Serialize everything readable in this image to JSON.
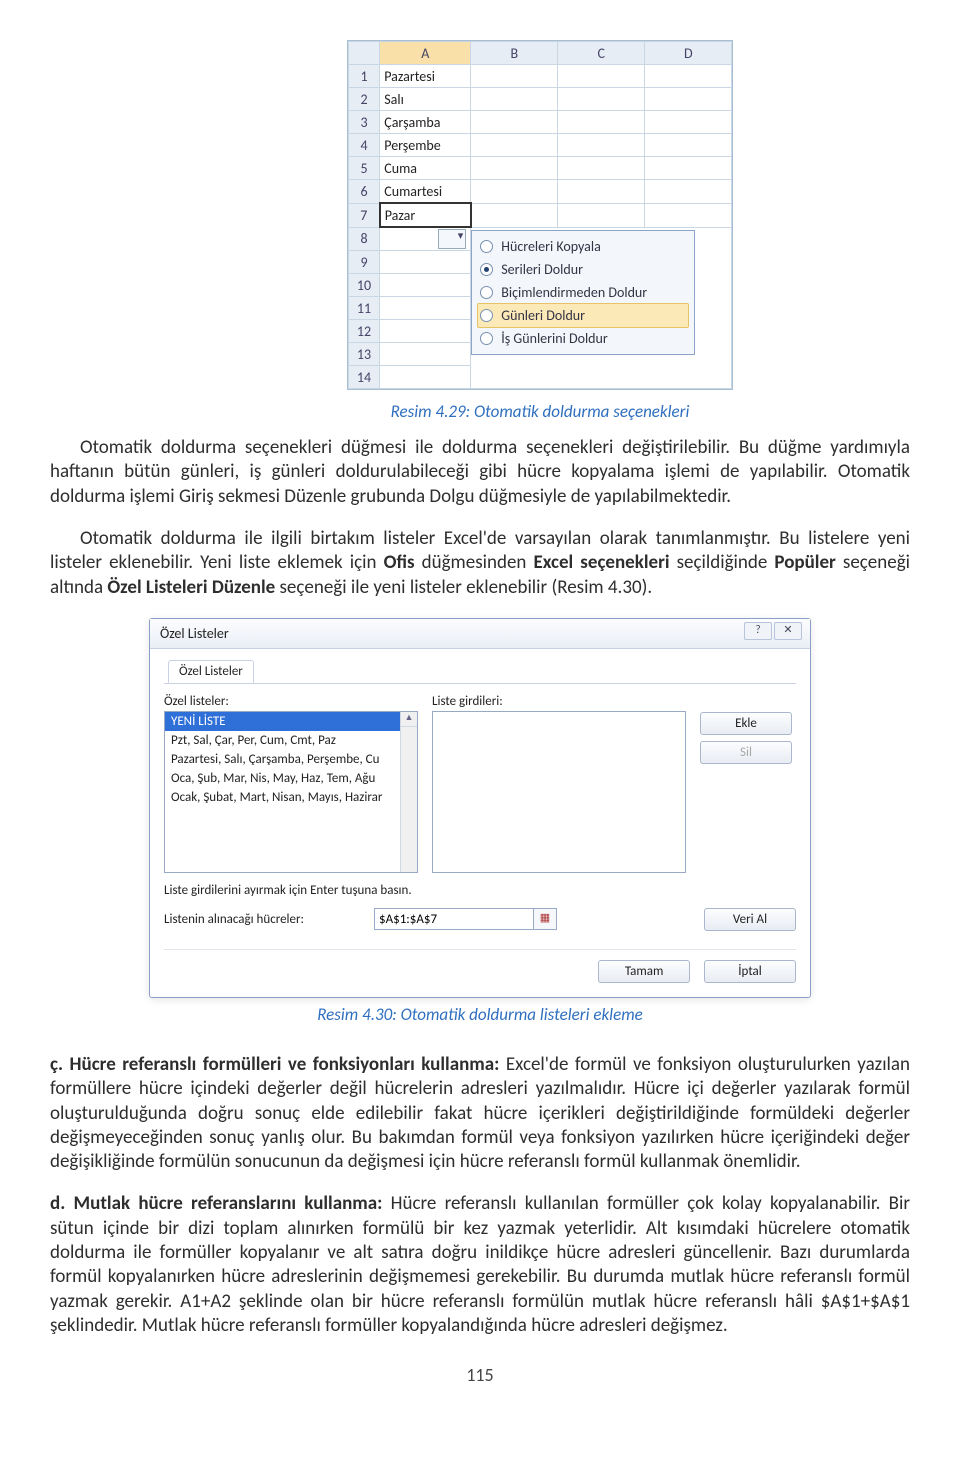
{
  "excel": {
    "cols": [
      "A",
      "B",
      "C",
      "D"
    ],
    "rows": [
      {
        "n": "1",
        "val": "Pazartesi"
      },
      {
        "n": "2",
        "val": "Salı"
      },
      {
        "n": "3",
        "val": "Çarşamba"
      },
      {
        "n": "4",
        "val": "Perşembe"
      },
      {
        "n": "5",
        "val": "Cuma"
      },
      {
        "n": "6",
        "val": "Cumartesi"
      },
      {
        "n": "7",
        "val": "Pazar"
      },
      {
        "n": "8",
        "val": ""
      },
      {
        "n": "9",
        "val": ""
      },
      {
        "n": "10",
        "val": ""
      },
      {
        "n": "11",
        "val": ""
      },
      {
        "n": "12",
        "val": ""
      },
      {
        "n": "13",
        "val": ""
      },
      {
        "n": "14",
        "val": ""
      }
    ],
    "menu": {
      "opt1": "Hücreleri Kopyala",
      "opt2": "Serileri Doldur",
      "opt3": "Biçimlendirmeden Doldur",
      "opt4": "Günleri Doldur",
      "opt5": "İş Günlerini Doldur"
    }
  },
  "caption1": "Resim 4.29: Otomatik doldurma seçenekleri",
  "para1": "Otomatik doldurma seçenekleri düğmesi ile doldurma seçenekleri değiştirilebilir. Bu düğme yardımıyla haftanın bütün günleri, iş günleri doldurulabileceği gibi hücre kopyalama işlemi de yapılabilir. Otomatik doldurma işlemi Giriş sekmesi Düzenle grubunda Dolgu düğmesiyle de yapılabilmektedir.",
  "para2_a": "Otomatik doldurma ile ilgili birtakım listeler Excel'de varsayılan olarak tanımlanmıştır. Bu listelere yeni listeler eklenebilir. Yeni liste eklemek için ",
  "para2_b": "Ofis",
  "para2_c": " düğmesinden ",
  "para2_d": "Excel seçenekleri",
  "para2_e": " seçildiğinde ",
  "para2_f": "Popüler",
  "para2_g": " seçeneği altında ",
  "para2_h": "Özel Listeleri Düzenle",
  "para2_i": " seçeneği ile yeni listeler eklenebilir (Resim 4.30).",
  "dialog": {
    "title": "Özel Listeler",
    "tab": "Özel Listeler",
    "left_label": "Özel listeler:",
    "right_label": "Liste girdileri:",
    "items": [
      "YENİ LİSTE",
      "Pzt, Sal, Çar, Per, Cum, Cmt, Paz",
      "Pazartesi, Salı, Çarşamba, Perşembe, Cu",
      "Oca, Şub, Mar, Nis, May, Haz, Tem, Ağu",
      "Ocak, Şubat, Mart, Nisan, Mayıs, Hazirar"
    ],
    "hint": "Liste girdilerini ayırmak için Enter tuşuna basın.",
    "from_label": "Listenin alınacağı hücreler:",
    "from_value": "$A$1:$A$7",
    "btn_add": "Ekle",
    "btn_del": "Sil",
    "btn_import": "Veri Al",
    "btn_ok": "Tamam",
    "btn_cancel": "İptal"
  },
  "caption2": "Resim 4.30: Otomatik doldurma listeleri ekleme",
  "para3_lead": "ç. Hücre referanslı formülleri ve fonksiyonları kullanma: ",
  "para3": "Excel'de formül ve fonksiyon oluşturulurken yazılan formüllere hücre içindeki değerler değil hücrelerin adresleri yazılmalıdır. Hücre içi değerler yazılarak formül oluşturulduğunda doğru sonuç elde edilebilir fakat hücre içerikleri değiştirildiğinde formüldeki değerler değişmeyeceğinden sonuç yanlış olur. Bu bakımdan formül veya fonksiyon yazılırken hücre içeriğindeki değer değişikliğinde formülün sonucunun da değişmesi için hücre referanslı formül kullanmak önemlidir.",
  "para4_lead": "d. Mutlak hücre referanslarını kullanma: ",
  "para4": "Hücre referanslı kullanılan formüller çok kolay kopyalanabilir. Bir sütun içinde bir dizi toplam alınırken formülü bir kez yazmak yeterlidir. Alt kısımdaki hücrelere otomatik doldurma ile formüller kopyalanır ve alt satıra doğru inildikçe hücre adresleri güncellenir. Bazı durumlarda formül kopyalanırken hücre adreslerinin değişmemesi gerekebilir. Bu durumda mutlak hücre referanslı formül yazmak gerekir. A1+A2 şeklinde olan bir hücre referanslı formülün mutlak hücre referanslı hâli $A$1+$A$1 şeklindedir. Mutlak hücre referanslı formüller kopyalandığında hücre adresleri değişmez.",
  "page": "115"
}
